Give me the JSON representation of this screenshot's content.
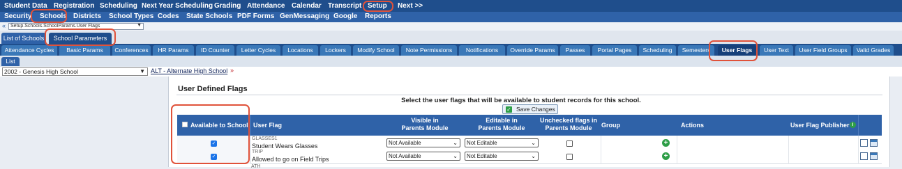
{
  "top_nav": [
    "Student Data",
    "Registration",
    "Scheduling",
    "Next Year Scheduling",
    "Grading",
    "Attendance",
    "Calendar",
    "Transcript",
    "Setup",
    "Next >>"
  ],
  "sub_nav": [
    "Security",
    "Schools",
    "Districts",
    "School Types",
    "Codes",
    "State Schools",
    "PDF Forms",
    "GenMessaging",
    "Google",
    "Reports"
  ],
  "breadcrumb": {
    "value": "Setup.Schools.SchoolParams.User Flags"
  },
  "page_tabs": [
    "List of Schools",
    "School Parameters"
  ],
  "param_tabs": [
    "Attendance Cycles",
    "Basic Params",
    "Conferences",
    "HR Params",
    "ID Counter",
    "Letter Cycles",
    "Locations",
    "Lockers",
    "Modify School",
    "Note Permissions",
    "Notifications",
    "Override Params",
    "Passes",
    "Portal Pages",
    "Scheduling",
    "Semesters",
    "User Flags",
    "User Text",
    "User Field Groups",
    "Valid Grades"
  ],
  "list_button": "List",
  "school": {
    "selected": "2002 - Genesis High School",
    "alt_name": "ALT - Alternate High School",
    "next": "»"
  },
  "panel": {
    "title": "User Defined Flags",
    "instruction": "Select the user flags that will be available to student records for this school.",
    "save_label": "Save Changes"
  },
  "table": {
    "headers": {
      "available": "Available to School",
      "user_flag": "User Flag",
      "visible_1": "Visible in",
      "visible_2": "Parents Module",
      "editable_1": "Editable in",
      "editable_2": "Parents Module",
      "unchecked_1": "Unchecked flags in",
      "unchecked_2": "Parents Module",
      "group": "Group",
      "actions": "Actions",
      "publisher": "User Flag Publisher"
    },
    "rows": [
      {
        "available": true,
        "code": "GLASSES1",
        "description": "Student Wears Glasses",
        "visible": "Not Available",
        "editable": "Not Editable",
        "unchecked": false
      },
      {
        "available": true,
        "code": "TRIP",
        "description": "Allowed to go on Field Trips",
        "visible": "Not Available",
        "editable": "Not Editable",
        "unchecked": false
      }
    ],
    "next_row_code": "ATH"
  },
  "colors": {
    "nav_dark": "#1f4e8c",
    "nav_mid": "#2f62a8",
    "highlight": "#e0523a",
    "add_green": "#2e9e47"
  }
}
